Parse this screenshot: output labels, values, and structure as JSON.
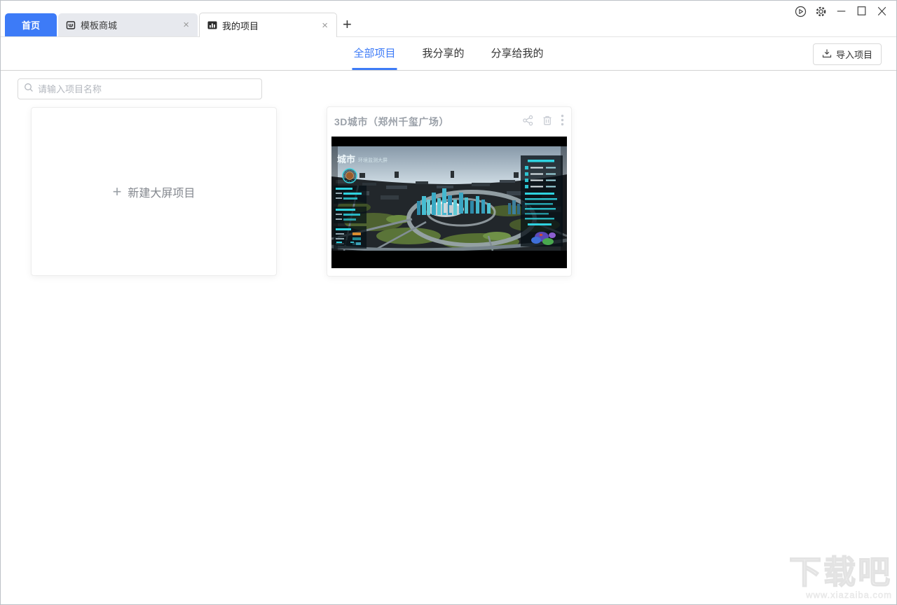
{
  "browser_tabs": {
    "items": [
      {
        "label": "首页",
        "state": "pinned-active",
        "closable": false
      },
      {
        "label": "模板商城",
        "icon": "store-icon",
        "state": "inactive",
        "closable": true
      },
      {
        "label": "我的项目",
        "icon": "bar-chart-icon",
        "state": "active",
        "closable": true
      }
    ],
    "new_tab_label": "+",
    "close_label": "×"
  },
  "titlebar": {
    "control_icons": [
      "preview-play-icon",
      "settings-gear-icon",
      "minimize-icon",
      "maximize-icon",
      "close-icon"
    ]
  },
  "nav": {
    "tabs": [
      {
        "label": "全部项目",
        "active": true
      },
      {
        "label": "我分享的",
        "active": false
      },
      {
        "label": "分享给我的",
        "active": false
      }
    ],
    "import_button": {
      "label": "导入项目",
      "icon": "import-icon"
    }
  },
  "search": {
    "placeholder": "请输入项目名称",
    "icon": "search-icon"
  },
  "cards": {
    "new_project": {
      "plus": "+",
      "label": "新建大屏项目"
    },
    "project": {
      "title": "3D城市（郑州千玺广场）",
      "action_icons": [
        "share-icon",
        "trash-icon",
        "more-icon"
      ],
      "thumbnail": {
        "heading_main": "城市",
        "heading_sub": "环境监测大屏",
        "description": "3D aerial city scene with ring road around central towers and teal telemetry panels"
      }
    }
  },
  "watermark": {
    "name": "下载吧",
    "url": "www.xiazaiba.com"
  },
  "colors": {
    "accent_blue": "#3D7BF7",
    "tab_inactive_bg": "#E7E9EE",
    "divider": "#D2D2D2",
    "muted_title": "#9BA1A9",
    "icon_gray": "#C8CCD3",
    "panel_teal": "#2FD3E0"
  }
}
